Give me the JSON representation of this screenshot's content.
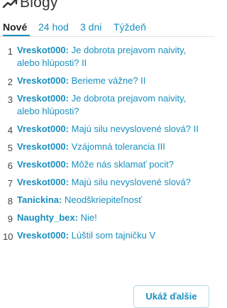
{
  "header": {
    "title": "Blogy",
    "icon": "trend-icon"
  },
  "tabs": [
    {
      "label": "Nové",
      "active": true
    },
    {
      "label": "24 hod",
      "active": false
    },
    {
      "label": "3 dni",
      "active": false
    },
    {
      "label": "Týždeň",
      "active": false
    }
  ],
  "items": [
    {
      "num": "1",
      "author": "Vreskot000:",
      "title": "Je dobrota prejavom naivity, alebo hlúposti? II"
    },
    {
      "num": "2",
      "author": "Vreskot000:",
      "title": "Berieme vážne? II"
    },
    {
      "num": "3",
      "author": "Vreskot000:",
      "title": "Je dobrota prejavom naivity, alebo hlúposti?"
    },
    {
      "num": "4",
      "author": "Vreskot000:",
      "title": "Majú silu nevyslovené slová? II"
    },
    {
      "num": "5",
      "author": "Vreskot000:",
      "title": "Vzájomná tolerancia III"
    },
    {
      "num": "6",
      "author": "Vreskot000:",
      "title": "Môže nás sklamať pocit?"
    },
    {
      "num": "7",
      "author": "Vreskot000:",
      "title": "Majú silu nevyslovené slová?"
    },
    {
      "num": "8",
      "author": "Tanickina:",
      "title": "Neodškriepiteľnosť"
    },
    {
      "num": "9",
      "author": "Naughty_bex:",
      "title": "Nie!"
    },
    {
      "num": "10",
      "author": "Vreskot000:",
      "title": "Lúštil som tajničku V"
    }
  ],
  "more_button": {
    "label": "Ukáž ďalšie"
  },
  "colors": {
    "accent": "#1a8fbf",
    "text": "#333333"
  }
}
